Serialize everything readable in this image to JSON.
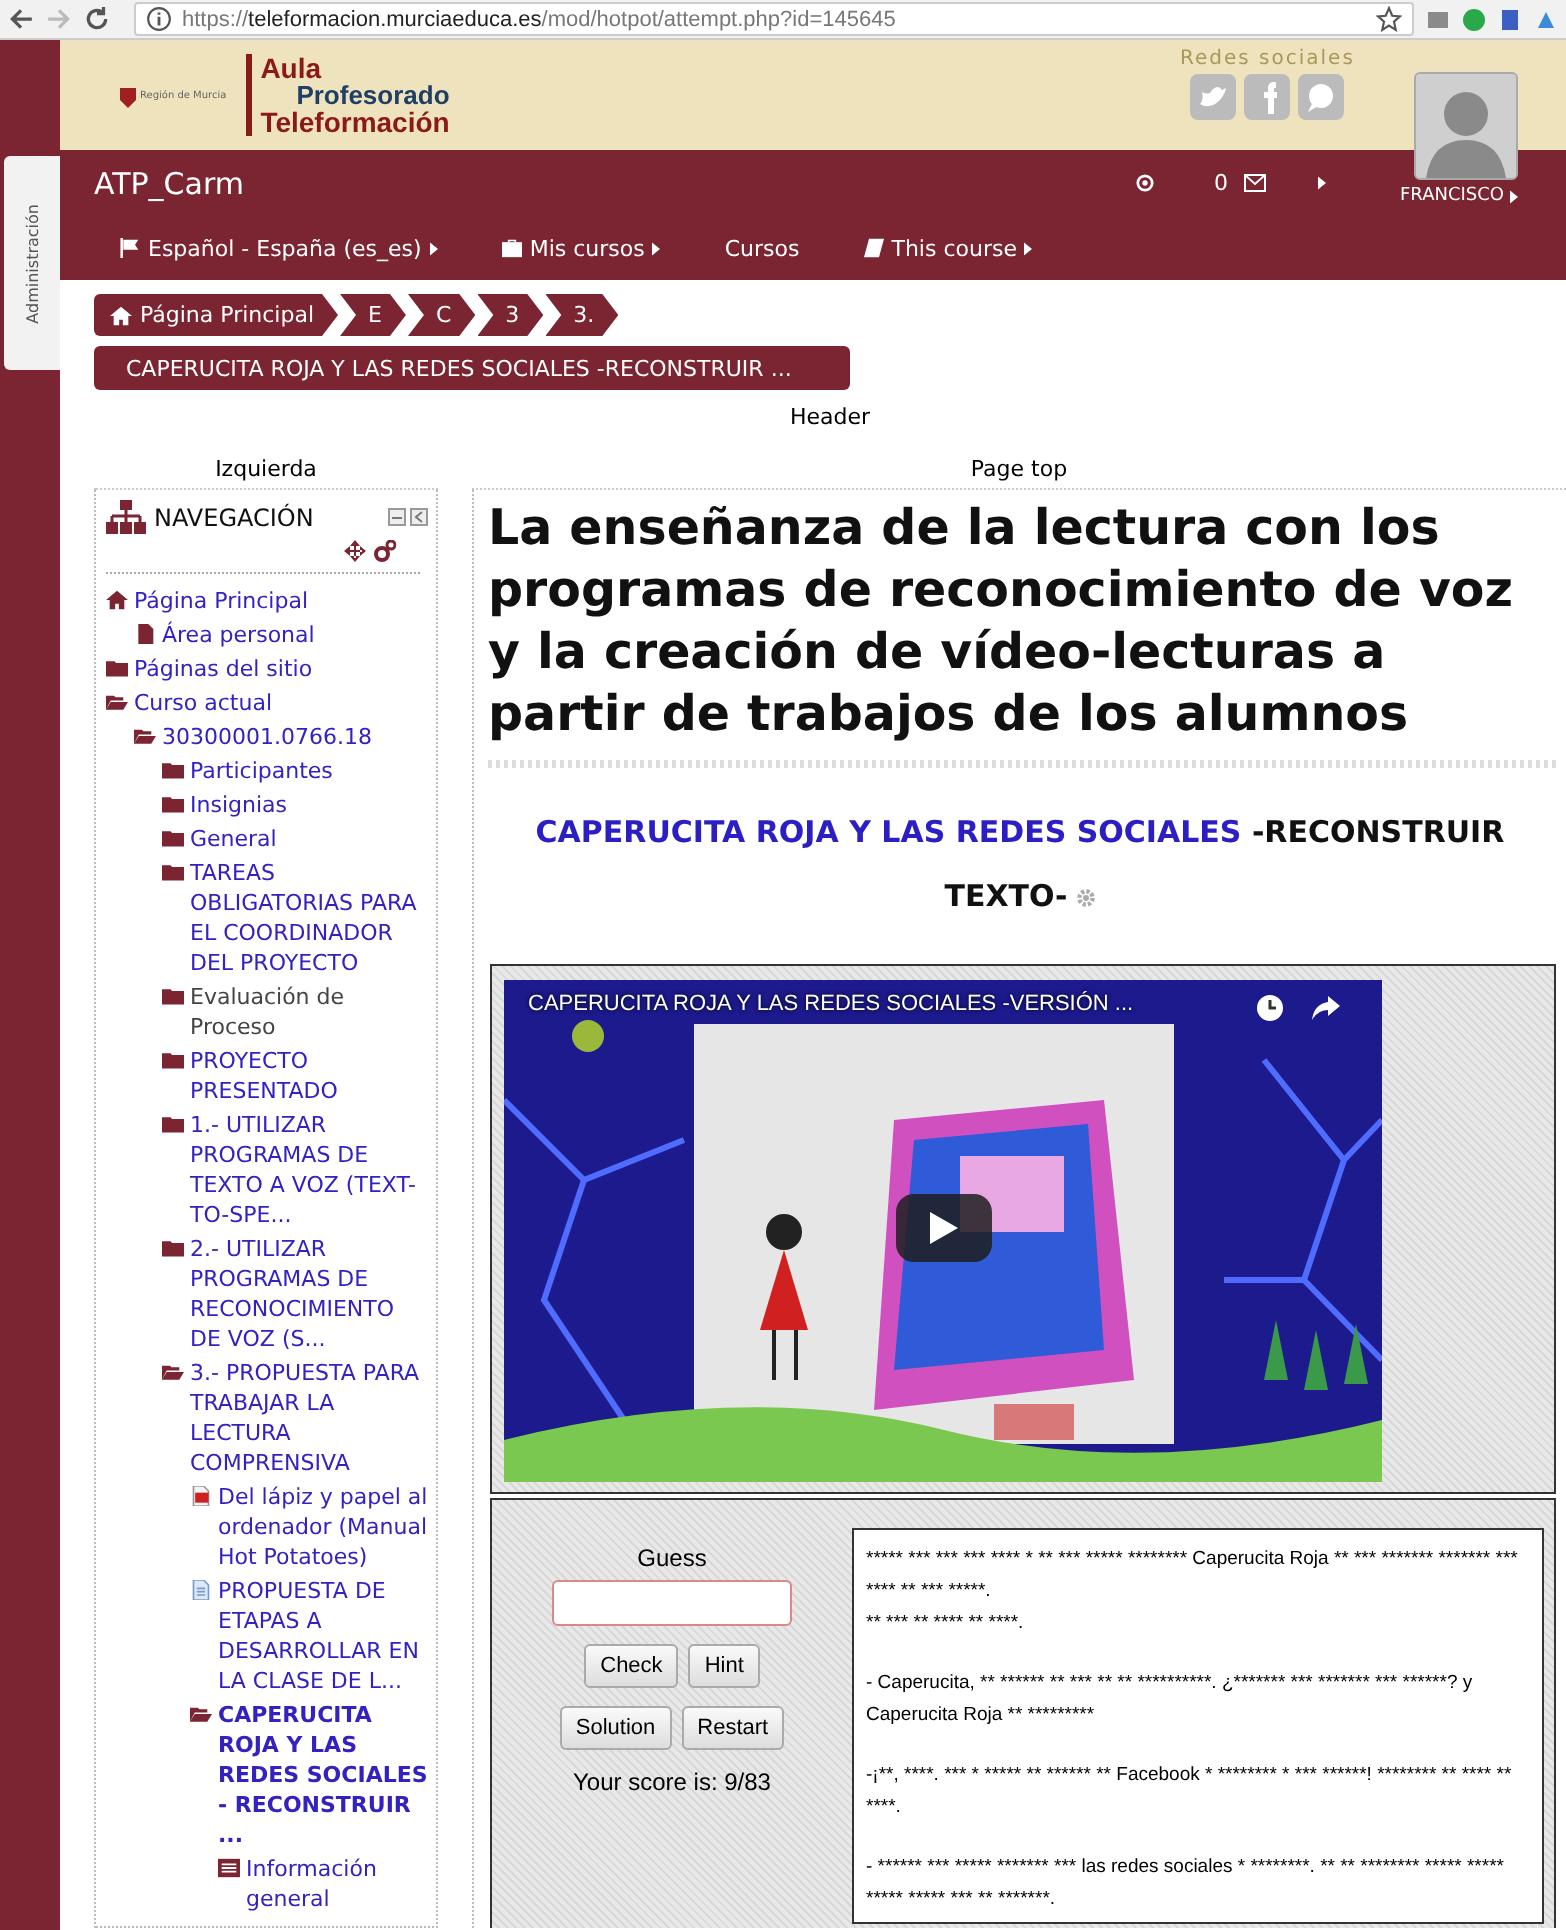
{
  "browser": {
    "url": {
      "scheme": "https://",
      "host": "teleformacion.murciaeduca.es",
      "path": "/mod/hotpot/attempt.php?id=145645"
    }
  },
  "admin_tab": {
    "label": "Administración"
  },
  "header": {
    "region": "Región de Murcia",
    "logo": [
      "Aula",
      "Profesorado",
      "Teleformación"
    ],
    "social_label": "Redes sociales",
    "site_name": "ATP_Carm",
    "message_count": "0",
    "user_name": "FRANCISCO"
  },
  "menu": [
    {
      "label": "Español - España (es_es)",
      "kind": "language"
    },
    {
      "label": "Mis cursos",
      "kind": "courses"
    },
    {
      "label": "Cursos",
      "kind": "plain"
    },
    {
      "label": "This course",
      "kind": "book"
    }
  ],
  "breadcrumbs": [
    {
      "label": "Página Principal",
      "kind": "home"
    },
    {
      "label": "E",
      "kind": "page"
    },
    {
      "label": "C",
      "kind": "page"
    },
    {
      "label": "3",
      "kind": "page"
    },
    {
      "label": "3.",
      "kind": "page"
    }
  ],
  "page_title_bar": "CAPERUCITA ROJA Y LAS REDES SOCIALES -RECONSTRUIR ...",
  "region_labels": {
    "header": "Header",
    "left": "Izquierda",
    "top": "Page top"
  },
  "navigation": {
    "title": "NAVEGACIÓN",
    "items": [
      {
        "label": "Página Principal",
        "kind": "home",
        "link": true,
        "selected": false,
        "children": [
          {
            "label": "Área personal",
            "kind": "page",
            "link": true,
            "selected": false
          }
        ]
      },
      {
        "label": "Páginas del sitio",
        "kind": "folder",
        "link": true,
        "selected": false
      },
      {
        "label": "Curso actual",
        "kind": "folder-open",
        "link": true,
        "selected": false,
        "children": [
          {
            "label": "30300001.0766.18",
            "kind": "folder-open",
            "link": true,
            "selected": false,
            "children": [
              {
                "label": "Participantes",
                "kind": "folder",
                "link": true,
                "selected": false
              },
              {
                "label": "Insignias",
                "kind": "folder",
                "link": true,
                "selected": false
              },
              {
                "label": "General",
                "kind": "folder",
                "link": true,
                "selected": false
              },
              {
                "label": "TAREAS OBLIGATORIAS PARA EL COORDINADOR DEL PROYECTO",
                "kind": "folder",
                "link": true,
                "selected": false
              },
              {
                "label": "Evaluación de Proceso",
                "kind": "folder",
                "link": false,
                "selected": false
              },
              {
                "label": "PROYECTO PRESENTADO",
                "kind": "folder",
                "link": true,
                "selected": false
              },
              {
                "label": "1.- UTILIZAR PROGRAMAS DE TEXTO A VOZ (TEXT-TO-SPE...",
                "kind": "folder",
                "link": true,
                "selected": false
              },
              {
                "label": "2.- UTILIZAR PROGRAMAS DE RECONOCIMIENTO DE VOZ (S...",
                "kind": "folder",
                "link": true,
                "selected": false
              },
              {
                "label": "3.- PROPUESTA PARA TRABAJAR LA LECTURA COMPRENSIVA",
                "kind": "folder-open",
                "link": true,
                "selected": false,
                "children": [
                  {
                    "label": "Del lápiz y papel al ordenador (Manual Hot Potatoes)",
                    "kind": "pdf",
                    "link": true,
                    "selected": false
                  },
                  {
                    "label": "PROPUESTA DE ETAPAS A DESARROLLAR EN LA CLASE DE L...",
                    "kind": "doc",
                    "link": true,
                    "selected": false
                  },
                  {
                    "label": "CAPERUCITA ROJA Y LAS REDES SOCIALES - RECONSTRUIR ...",
                    "kind": "folder-open",
                    "link": true,
                    "selected": true,
                    "children": [
                      {
                        "label": "Información general",
                        "kind": "report",
                        "link": true,
                        "selected": false
                      }
                    ]
                  }
                ]
              }
            ]
          }
        ]
      }
    ]
  },
  "main": {
    "heading": "La enseñanza de la lectura con los programas de reconocimiento de voz y la creación de vídeo-lecturas a partir de trabajos de los alumnos",
    "activity": {
      "title": "CAPERUCITA ROJA Y LAS REDES SOCIALES",
      "suffix": " -RECONSTRUIR TEXTO-"
    },
    "video": {
      "title": "CAPERUCITA ROJA Y LAS REDES SOCIALES -VERSIÓN ..."
    },
    "quiz": {
      "guess_label": "Guess",
      "button_rows": [
        [
          "Check",
          "Hint"
        ],
        [
          "Solution",
          "Restart"
        ]
      ],
      "score": "Your score is: 9/83",
      "paragraphs": [
        [
          "***** *** *** *** **** * ** *** ***** ******** Caperucita Roja ** *** ******* ******* *** **** ** *** *****.",
          "** *** ** **** ** ****."
        ],
        [
          "- Caperucita, ** ****** ** *** ** ** **********. ¿******* *** ******* *** ******? y Caperucita Roja ** *********"
        ],
        [
          "-¡**, ****. *** * ***** ** ****** ** Facebook * ******** * *** ******! ******** ** **** ** ****."
        ],
        [
          "- ****** *** ***** ******* *** las redes sociales * ********. ** ** ******** ***** ***** ***** ***** *** ** *******."
        ]
      ]
    }
  }
}
